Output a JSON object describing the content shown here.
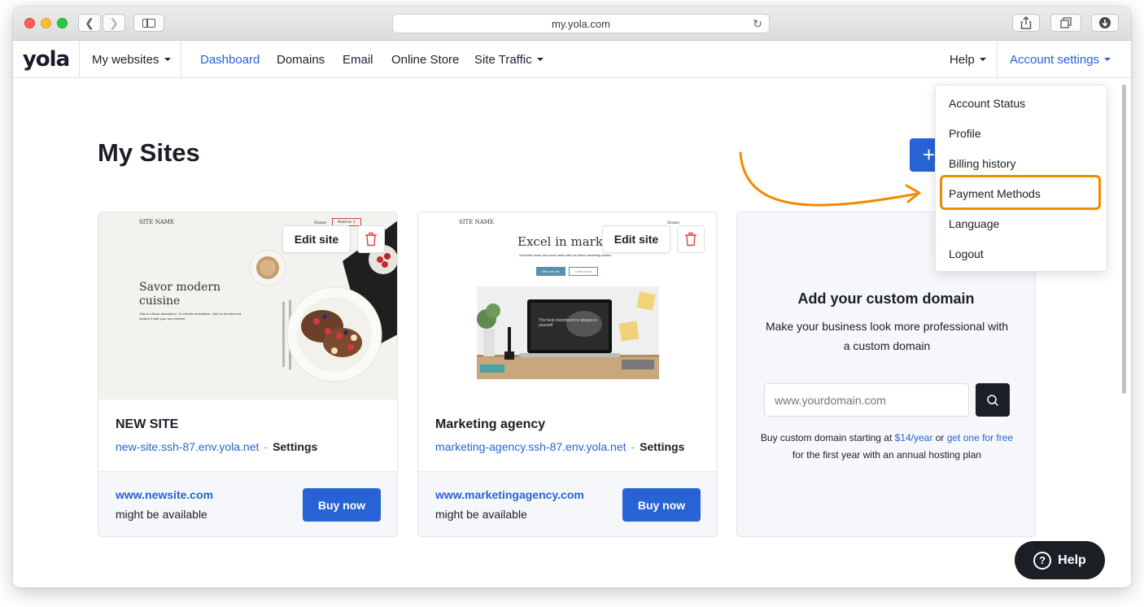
{
  "browser": {
    "url": "my.yola.com",
    "back_icon": "chevron-left-icon",
    "forward_icon": "chevron-right-icon",
    "sidebar_icon": "sidebar-icon",
    "reload_icon": "reload-icon",
    "share_icon": "share-icon",
    "tabs_icon": "tabs-icon",
    "download_icon": "download-icon"
  },
  "nav": {
    "logo": "yola",
    "my_websites": "My websites",
    "links": [
      "Dashboard",
      "Domains",
      "Email",
      "Online Store",
      "Site Traffic"
    ],
    "help": "Help",
    "account_settings": "Account settings"
  },
  "page": {
    "title": "My Sites",
    "add_button": "+"
  },
  "sites": [
    {
      "name": "NEW SITE",
      "url": "new-site.ssh-87.env.yola.net",
      "separator": "-",
      "settings": "Settings",
      "domain": "www.newsite.com",
      "availability": "might be available",
      "buy_label": "Buy now",
      "edit_label": "Edit site",
      "thumb": {
        "site_name": "SITE NAME",
        "nav_home": "Home",
        "nav_button": "Button 2",
        "headline": "Savor modern cuisine",
        "body": "This is a block description. To edit this description, click on the text and replace it with your own content."
      }
    },
    {
      "name": "Marketing agency",
      "url": "marketing-agency.ssh-87.env.yola.net",
      "separator": "-",
      "settings": "Settings",
      "domain": "www.marketingagency.com",
      "availability": "might be available",
      "buy_label": "Buy now",
      "edit_label": "Edit site",
      "thumb": {
        "site_name": "SITE NAME",
        "nav_home": "Home",
        "headline": "Excel in market",
        "sub": "Generate leads and close sales with the latest marketing tactics",
        "btn1": "Who we are",
        "btn2": "Learn more",
        "screen_text": "The best investment is always in yourself"
      }
    }
  ],
  "custom_domain": {
    "title": "Add your custom domain",
    "subtitle": "Make your business look more professional with a custom domain",
    "placeholder": "www.yourdomain.com",
    "search_icon": "search-icon",
    "note_prefix": "Buy custom domain starting at ",
    "price": "$14/year",
    "note_mid": " or ",
    "link": "get one for free",
    "note_suffix": " for the first year with an annual hosting plan"
  },
  "account_menu": {
    "items": [
      "Account Status",
      "Profile",
      "Billing history",
      "Payment Methods",
      "Language",
      "Logout"
    ],
    "highlighted": "Payment Methods"
  },
  "help_fab": {
    "label": "Help",
    "icon": "question-circle-icon"
  },
  "colors": {
    "accent": "#2763d4",
    "highlight": "#f08b00",
    "dark": "#1c1e26"
  }
}
